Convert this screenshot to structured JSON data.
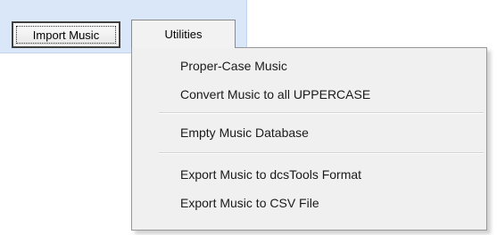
{
  "menubar": {
    "import_label": "Import Music",
    "utilities_label": "Utilities"
  },
  "utilities_menu": {
    "items": [
      {
        "label": "Proper-Case Music"
      },
      {
        "label": "Convert Music to all UPPERCASE"
      },
      {
        "label": "Empty Music Database"
      },
      {
        "label": "Export Music to dcsTools Format"
      },
      {
        "label": "Export Music to CSV File"
      }
    ]
  },
  "colors": {
    "menubar_background": "#dae7f8",
    "dropdown_background": "#f0f0f0",
    "border": "#979797"
  }
}
